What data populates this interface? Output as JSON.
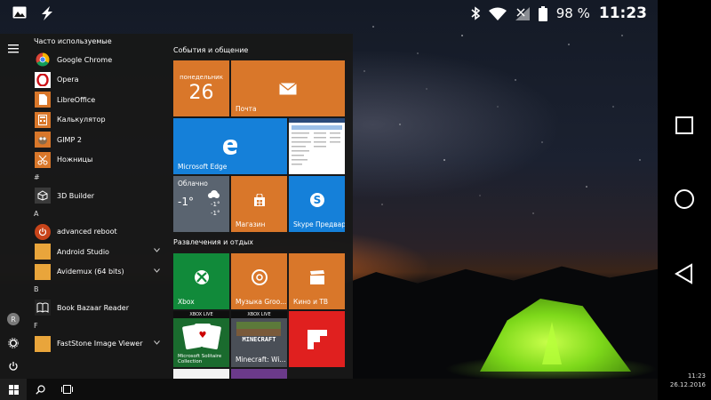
{
  "statusbar": {
    "battery_percent": "98 %",
    "time": "11:23",
    "icons": [
      "image-icon",
      "flash-icon",
      "bluetooth-icon",
      "wifi-icon",
      "signal-icon",
      "battery-icon"
    ]
  },
  "navbar": {
    "icons": [
      "square-icon",
      "circle-icon",
      "triangle-back-icon"
    ]
  },
  "startmenu": {
    "most_used_header": "Часто используемые",
    "most_used": [
      {
        "label": "Google Chrome",
        "icon": "chrome-icon",
        "color": "#ffffff"
      },
      {
        "label": "Opera",
        "icon": "opera-icon",
        "color": "#cc0f16"
      },
      {
        "label": "LibreOffice",
        "icon": "libreoffice-icon",
        "color": "#e0762b"
      },
      {
        "label": "Калькулятор",
        "icon": "calculator-icon",
        "color": "#e0762b"
      },
      {
        "label": "GIMP 2",
        "icon": "gimp-icon",
        "color": "#e0762b"
      },
      {
        "label": "Ножницы",
        "icon": "scissors-icon",
        "color": "#e0762b"
      }
    ],
    "sections": [
      {
        "letter": "#",
        "apps": [
          {
            "label": "3D Builder",
            "icon": "3d-builder-icon",
            "color": "#3a3a3a",
            "expandable": false
          }
        ]
      },
      {
        "letter": "A",
        "apps": [
          {
            "label": "advanced reboot",
            "icon": "power-reboot-icon",
            "color": "#c8441a",
            "expandable": false
          },
          {
            "label": "Android Studio",
            "icon": "folder-icon",
            "color": "#e9a53b",
            "expandable": true
          },
          {
            "label": "Avidemux (64 bits)",
            "icon": "folder-icon",
            "color": "#e9a53b",
            "expandable": true
          }
        ]
      },
      {
        "letter": "B",
        "apps": [
          {
            "label": "Book Bazaar Reader",
            "icon": "book-icon",
            "color": "#222222",
            "expandable": false
          }
        ]
      },
      {
        "letter": "F",
        "apps": [
          {
            "label": "FastStone Image Viewer",
            "icon": "folder-icon",
            "color": "#e9a53b",
            "expandable": true
          }
        ]
      }
    ],
    "rail_avatar_letter": "R",
    "tile_groups": [
      {
        "label": "События и общение"
      },
      {
        "label": "Развлечения и отдых"
      }
    ],
    "tiles": {
      "calendar": {
        "weekday": "понедельник",
        "day": "26"
      },
      "mail": {
        "label": "Почта"
      },
      "edge": {
        "label": "Microsoft Edge"
      },
      "weather": {
        "label": "Облачно",
        "temp_now": "-1°",
        "temp_high": "-1°",
        "temp_low": "-1°"
      },
      "store": {
        "label": "Магазин"
      },
      "skype": {
        "label": "Skype Предварите..."
      },
      "xbox": {
        "label": "Xbox"
      },
      "groove": {
        "label": "Музыка Groo..."
      },
      "movies": {
        "label": "Кино и ТВ"
      },
      "solitaire": {
        "badge": "XBOX LIVE",
        "label": "Microsoft Solitaire Collection"
      },
      "minecraft": {
        "badge": "XBOX LIVE",
        "label": "Minecraft: Wi...",
        "logo_text": "MINECRAFT"
      },
      "flipboard": {
        "label": ""
      }
    }
  },
  "taskbar": {
    "clock_time": "11:23",
    "clock_date": "26.12.2016"
  },
  "colors": {
    "orange_tile": "#d9772a",
    "blue_tile": "#1580d9",
    "green_tile": "#118a3a",
    "red_tile": "#e0201f",
    "weather_tile": "#5a6470"
  }
}
